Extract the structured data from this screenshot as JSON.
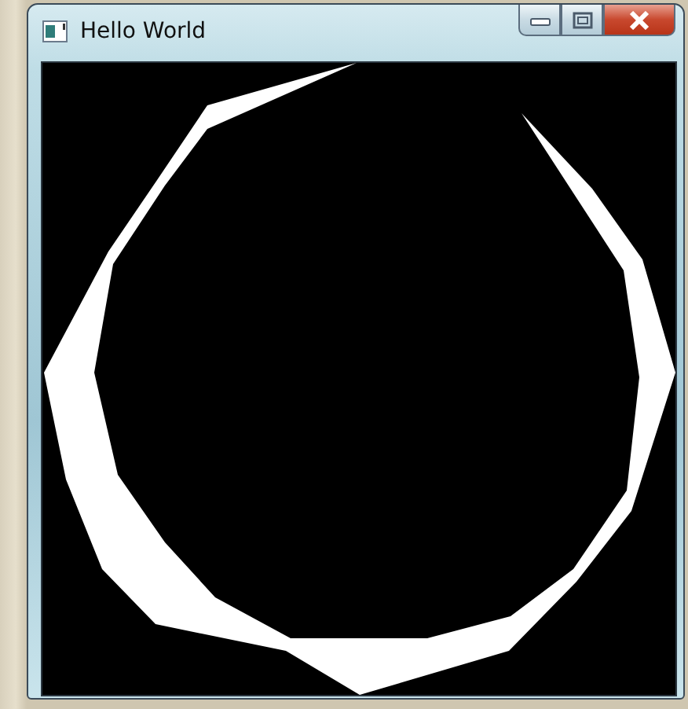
{
  "window": {
    "title": "Hello World"
  }
}
